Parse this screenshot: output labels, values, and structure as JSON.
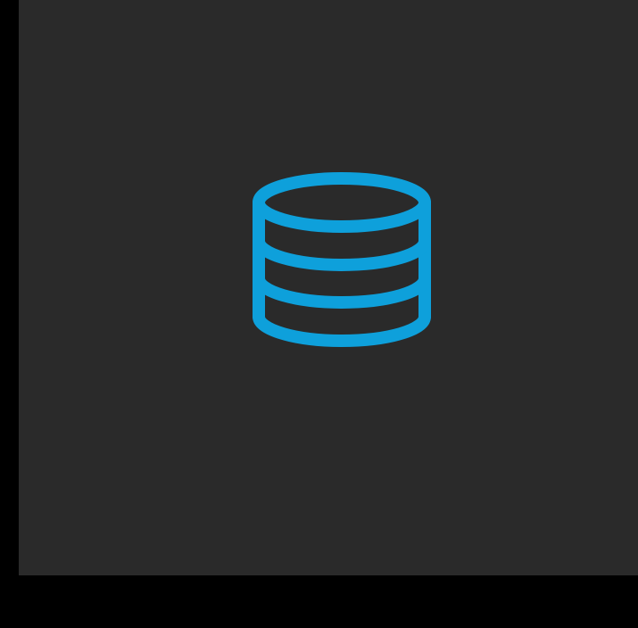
{
  "window": {
    "background_color": "#000000",
    "panel_color": "#2a2a2a"
  },
  "main": {
    "icon": {
      "name": "database-icon",
      "color": "#0ea0db"
    }
  }
}
